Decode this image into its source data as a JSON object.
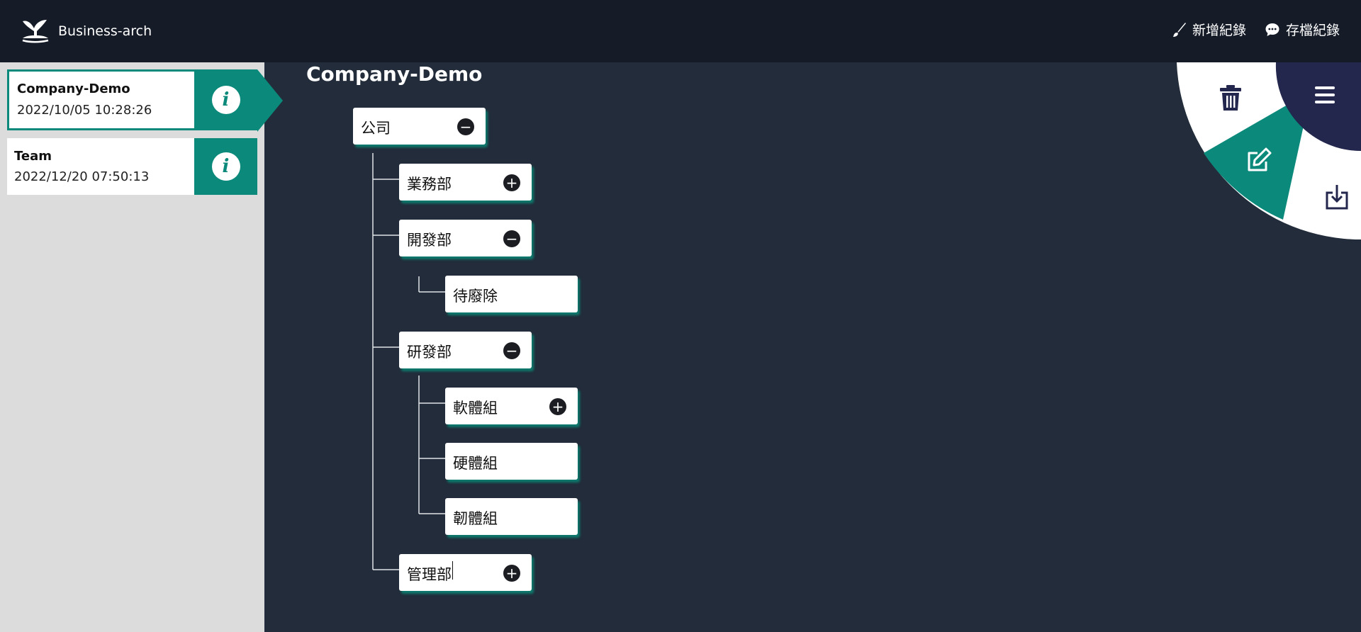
{
  "header": {
    "brand": "Business-arch",
    "actions": [
      {
        "label": "新增紀錄",
        "icon": "brush-icon"
      },
      {
        "label": "存檔紀錄",
        "icon": "chat-icon"
      }
    ]
  },
  "sidebar": {
    "records": [
      {
        "title": "Company-Demo",
        "date": "2022/10/05 10:28:26",
        "info": "i",
        "active": true
      },
      {
        "title": "Team",
        "date": "2022/12/20 07:50:13",
        "info": "i",
        "active": false
      }
    ]
  },
  "main": {
    "title": "Company-Demo",
    "nodes": [
      {
        "label": "公司",
        "toggle": "−"
      },
      {
        "label": "業務部",
        "toggle": "+"
      },
      {
        "label": "開發部",
        "toggle": "−"
      },
      {
        "label": "待廢除",
        "toggle": ""
      },
      {
        "label": "研發部",
        "toggle": "−"
      },
      {
        "label": "軟體組",
        "toggle": "+"
      },
      {
        "label": "硬體組",
        "toggle": ""
      },
      {
        "label": "韌體組",
        "toggle": ""
      },
      {
        "label": "管理部",
        "toggle": "+"
      }
    ]
  },
  "radial_menu": {
    "items": [
      "trash-icon",
      "menu-icon",
      "edit-icon",
      "download-icon"
    ]
  },
  "colors": {
    "accent": "#0b8a7b",
    "header_bg": "#151c28",
    "main_bg": "#222c3a",
    "sidebar_bg": "#dcdcdc",
    "radial_dark": "#23264d"
  }
}
